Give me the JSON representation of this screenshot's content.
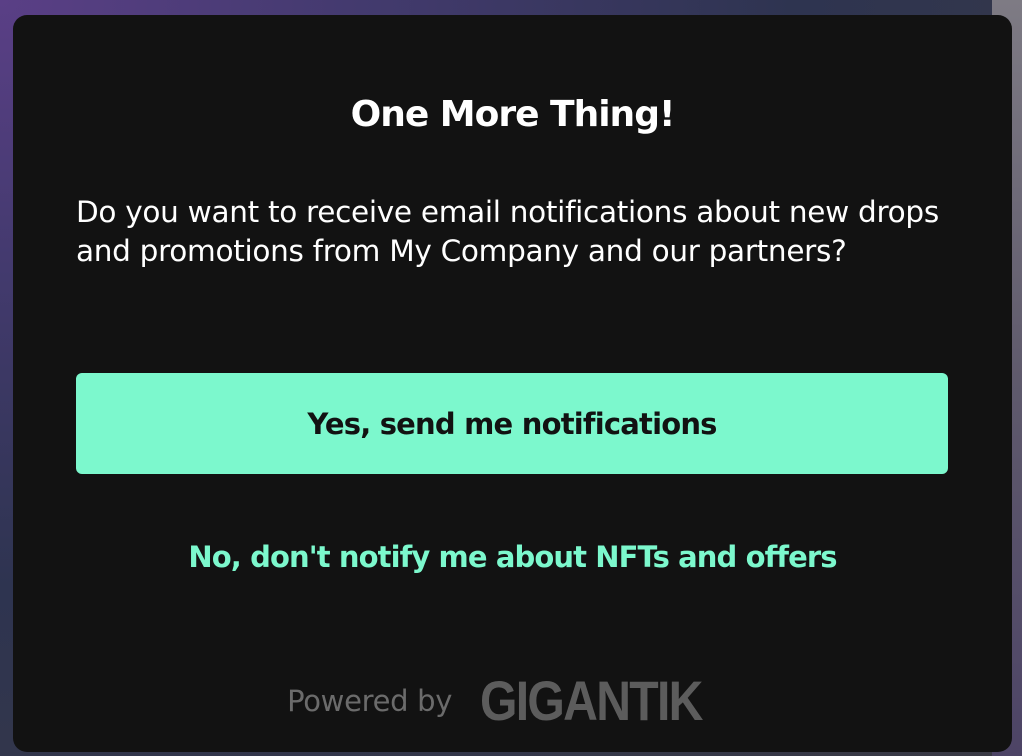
{
  "modal": {
    "title": "One More Thing!",
    "description": "Do you want to receive email notifications about new drops and promotions from My Company and our partners?",
    "accept_button": "Yes, send me notifications",
    "decline_link": "No, don't notify me about NFTs and offers"
  },
  "footer": {
    "powered_by": "Powered by",
    "logo_text": "GIGANTIK"
  },
  "colors": {
    "accent": "#7cf8cd",
    "modal_background": "#121212",
    "text": "#ffffff",
    "muted": "#6b6b6b"
  }
}
